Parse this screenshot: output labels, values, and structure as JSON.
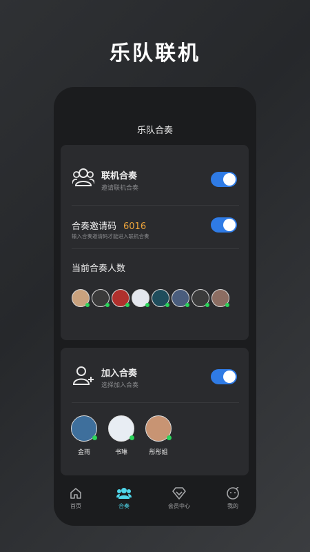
{
  "promo": {
    "title": "乐队联机"
  },
  "header": {
    "title": "乐队合奏"
  },
  "online_play": {
    "title": "联机合奏",
    "subtitle": "邀请联机合奏",
    "enabled": true
  },
  "invite_code": {
    "label": "合奏邀请码",
    "code": "6016",
    "hint": "输入合奏邀请码才能进入联机合奏",
    "enabled": true
  },
  "current_players": {
    "label": "当前合奏人数",
    "avatars": [
      {
        "color": "#c9a27e",
        "online": true
      },
      {
        "color": "#3a3a3a",
        "online": true
      },
      {
        "color": "#b0302d",
        "online": true
      },
      {
        "color": "#e4e7ee",
        "online": true
      },
      {
        "color": "#1f4d5c",
        "online": true
      },
      {
        "color": "#4a5d7d",
        "online": true
      },
      {
        "color": "#3b3b3b",
        "online": true
      },
      {
        "color": "#8c6d62",
        "online": true
      }
    ]
  },
  "join": {
    "title": "加入合奏",
    "subtitle": "选择加入合奏",
    "enabled": true
  },
  "friends": [
    {
      "name": "金雨",
      "color": "#3e6f9c",
      "online": true
    },
    {
      "name": "书琳",
      "color": "#e8edf3",
      "online": true
    },
    {
      "name": "彤彤姐",
      "color": "#c89473",
      "online": true
    }
  ],
  "tabs": [
    {
      "label": "首页",
      "icon": "home-icon",
      "active": false
    },
    {
      "label": "合奏",
      "icon": "group-icon",
      "active": true
    },
    {
      "label": "会员中心",
      "icon": "diamond-icon",
      "active": false
    },
    {
      "label": "我的",
      "icon": "profile-icon",
      "active": false
    }
  ],
  "colors": {
    "accent": "#2f7be5",
    "code": "#e9a23b",
    "online": "#2bd45a",
    "active_tab": "#4fd6ea"
  }
}
